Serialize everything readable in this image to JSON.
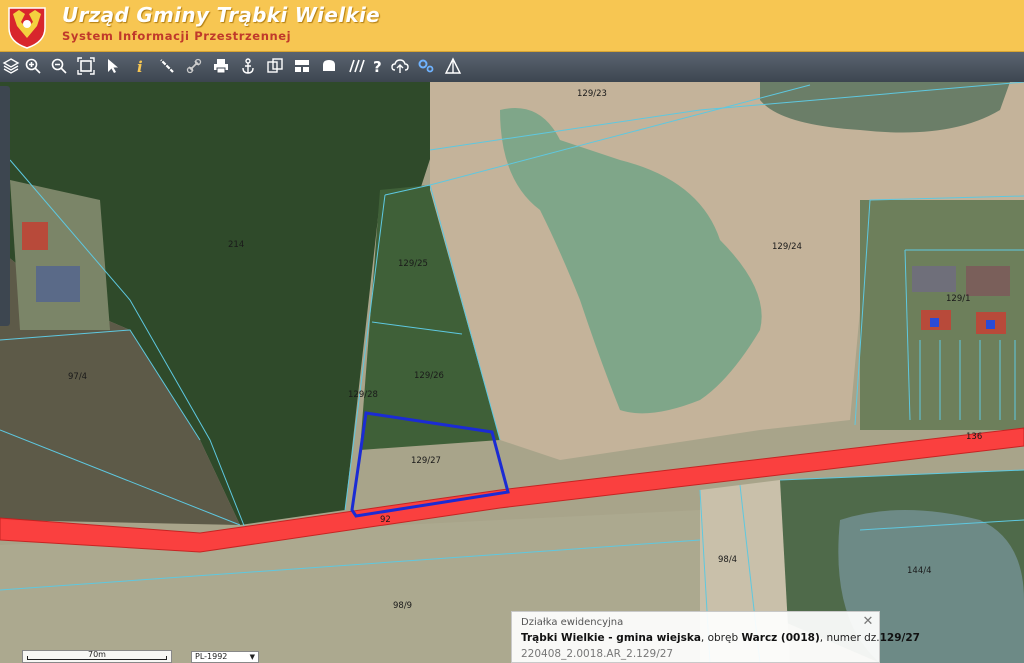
{
  "header": {
    "title": "Urząd Gminy Trąbki Wielkie",
    "subtitle": "System Informacji Przestrzennej",
    "brand_color": "#f7c652",
    "subtitle_color": "#c0392b"
  },
  "toolbar": {
    "tools": [
      "layers-icon",
      "zoom-in-icon",
      "zoom-out-icon",
      "zoom-extent-icon",
      "pointer-icon",
      "info-icon",
      "measure-icon",
      "link-icon",
      "print-icon",
      "anchor-icon",
      "copy-icon",
      "layout-icon",
      "shape-icon",
      "hatch-icon",
      "help-icon",
      "upload-icon",
      "settings-icon",
      "scale-icon"
    ]
  },
  "map": {
    "parcel_labels": [
      "129/23",
      "214",
      "129/24",
      "129/25",
      "129/26",
      "129/28",
      "129/27",
      "129/1",
      "97/4",
      "92",
      "136",
      "98/4",
      "98/9",
      "144/4"
    ],
    "selected_parcel": "129/27",
    "road_color": "#ff3b3b",
    "selection_color": "#1b2bd4",
    "parcel_line_color": "#5ec8e0"
  },
  "infobox": {
    "title": "Działka ewidencyjna",
    "gmina": "Trąbki Wielkie - gmina wiejska",
    "sep1": ", obręb ",
    "obreb": "Warcz (0018)",
    "sep2": ", numer dz.",
    "numer": "129/27",
    "identifier": "220408_2.0018.AR_2.129/27"
  },
  "scale": {
    "label": "70m"
  },
  "crs": {
    "selected": "PL-1992"
  }
}
